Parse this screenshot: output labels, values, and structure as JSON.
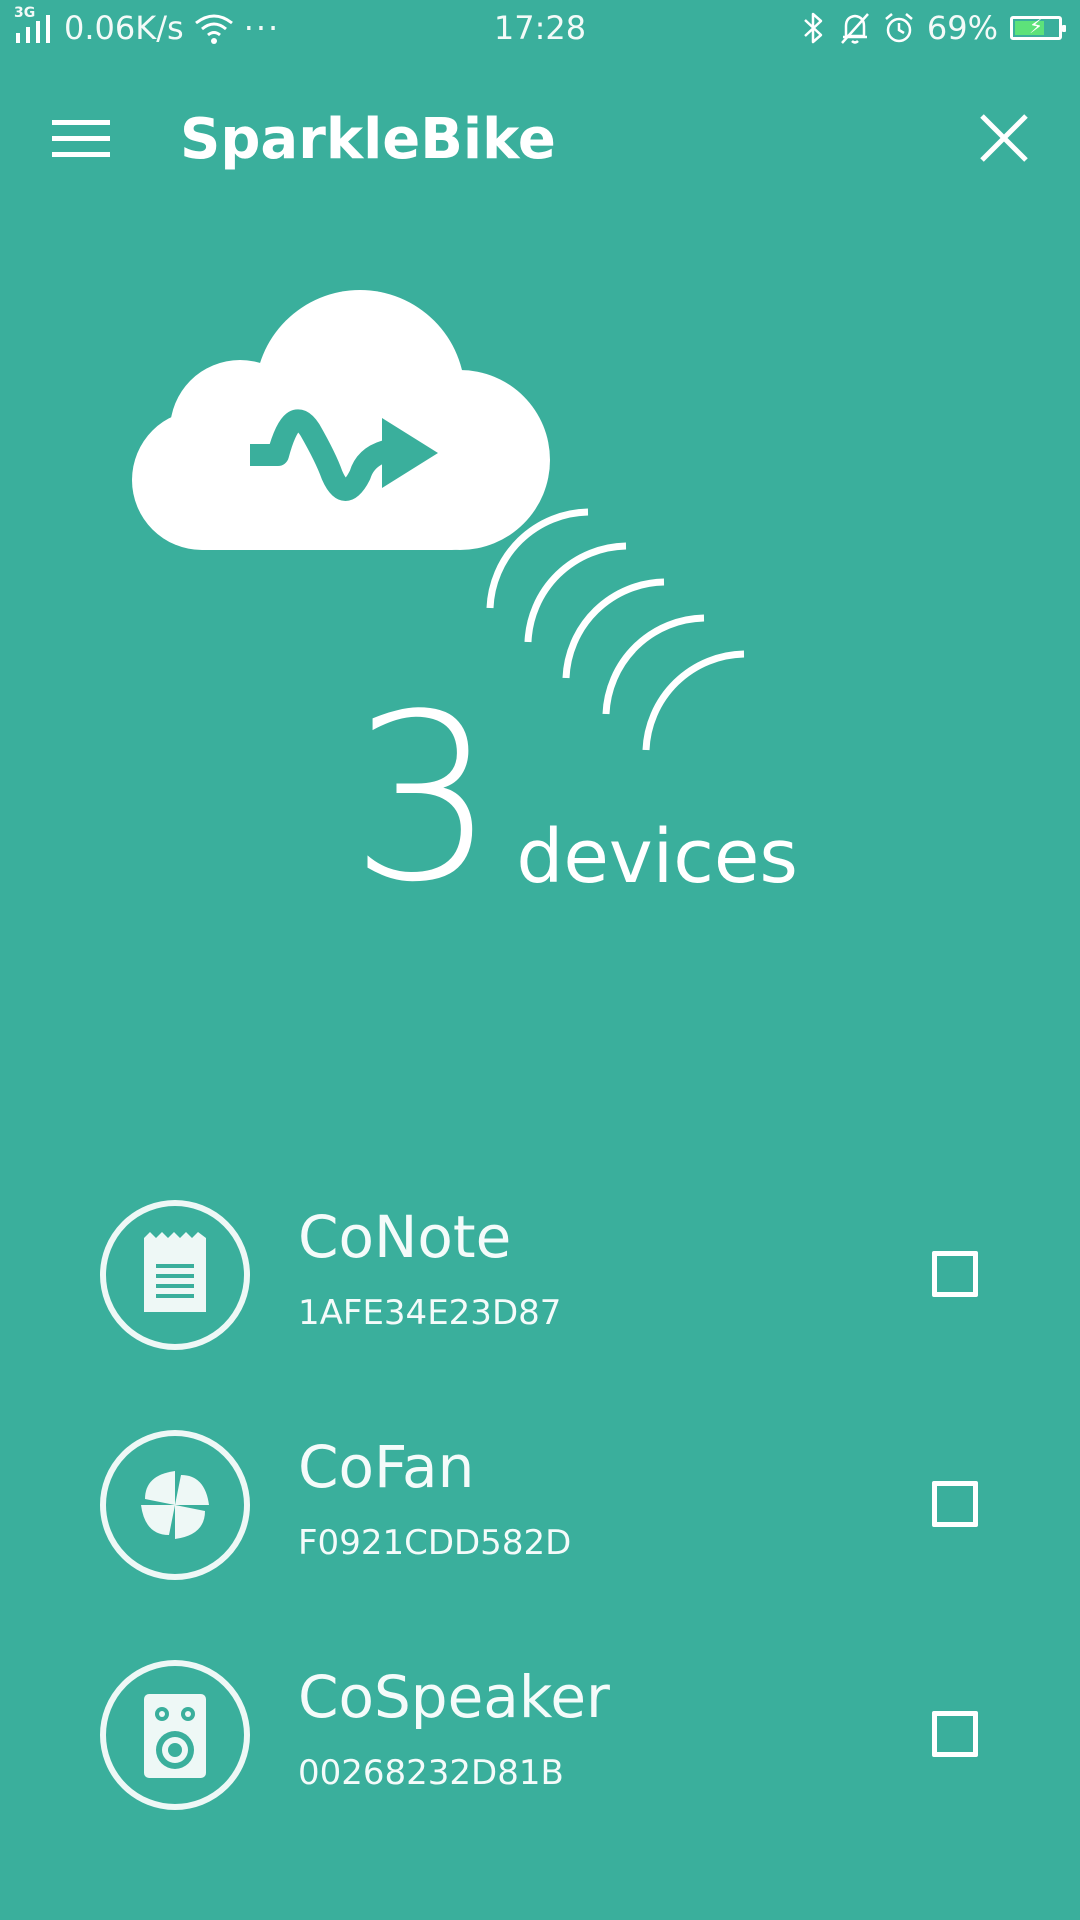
{
  "status_bar": {
    "network": "3G",
    "speed": "0.06K/s",
    "more": "···",
    "time": "17:28",
    "battery": "69%",
    "battery_level": 0.69
  },
  "header": {
    "title": "SparkleBike"
  },
  "hero": {
    "count": "3",
    "count_label": "devices"
  },
  "devices": [
    {
      "name": "CoNote",
      "id": "1AFE34E23D87",
      "icon": "notepad-icon",
      "checked": false
    },
    {
      "name": "CoFan",
      "id": "F0921CDD582D",
      "icon": "fan-icon",
      "checked": false
    },
    {
      "name": "CoSpeaker",
      "id": "00268232D81B",
      "icon": "speaker-icon",
      "checked": false
    }
  ],
  "colors": {
    "background": "#3aaf9c",
    "foreground": "#ffffff",
    "battery_fill": "#5de27a"
  }
}
